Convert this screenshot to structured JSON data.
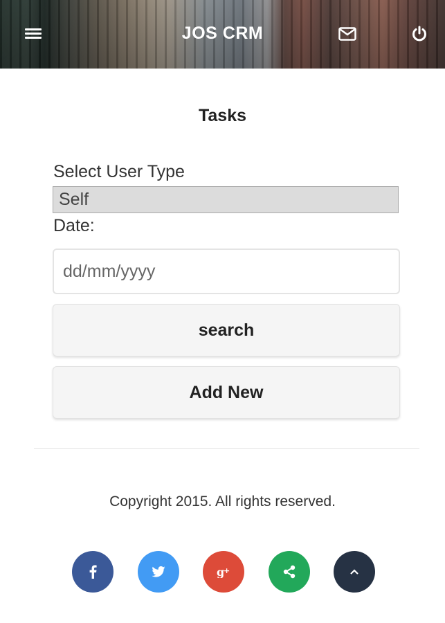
{
  "header": {
    "title": "JOS CRM",
    "menu_icon": "hamburger-menu-icon",
    "mail_icon": "envelope-icon",
    "power_icon": "power-icon"
  },
  "main": {
    "page_title": "Tasks",
    "user_type_label": "Select User Type",
    "user_type_value": "Self",
    "date_label": "Date:",
    "date_placeholder": "dd/mm/yyyy",
    "search_button": "search",
    "add_new_button": "Add New"
  },
  "footer": {
    "copyright": "Copyright 2015. All rights reserved.",
    "social": [
      {
        "icon": "facebook-icon",
        "color": "#3b5998"
      },
      {
        "icon": "twitter-icon",
        "color": "#429bf4"
      },
      {
        "icon": "google-plus-icon",
        "color": "#dd4b39"
      },
      {
        "icon": "share-icon",
        "color": "#22a85a"
      },
      {
        "icon": "chevron-up-icon",
        "color": "#263244"
      }
    ]
  }
}
